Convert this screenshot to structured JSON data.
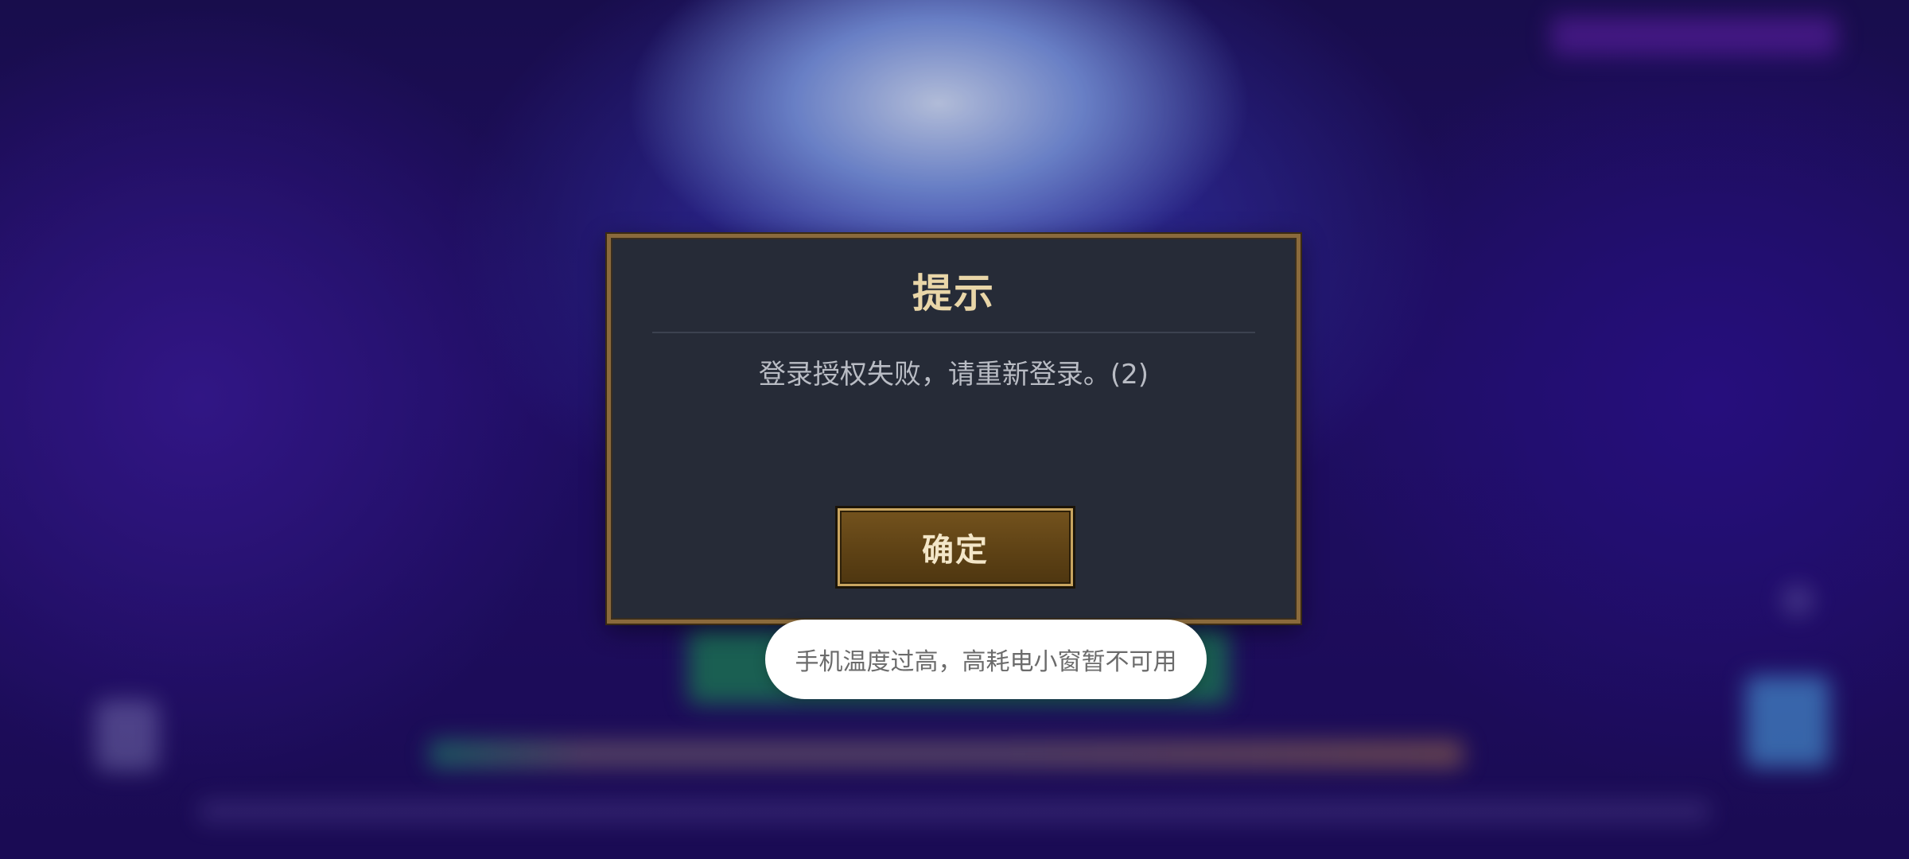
{
  "background": {
    "description_colors": {
      "base": "#1c0f55",
      "glow": "#d6e4ff",
      "green_button": "#1e965a",
      "side_icon": "#50aaf0"
    }
  },
  "dialog": {
    "title": "提示",
    "message": "登录授权失败，请重新登录。(2)",
    "confirm_label": "确定",
    "colors": {
      "panel": "#262b37",
      "border": "#8a6a3c",
      "title": "#e9d6a8",
      "button": "#5e4215"
    }
  },
  "toast": {
    "text": "手机温度过高，高耗电小窗暂不可用"
  }
}
